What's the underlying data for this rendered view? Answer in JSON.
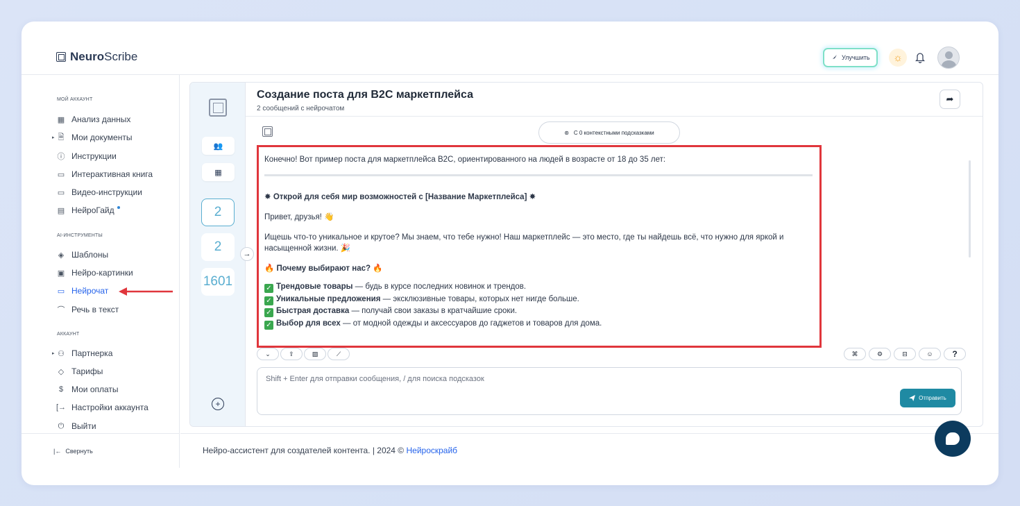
{
  "app": {
    "logo_bold": "Neuro",
    "logo_light": "Scribe"
  },
  "header": {
    "upgrade_label": "Улучшить",
    "sun_icon": "☼",
    "bell_icon": "🔔"
  },
  "sidebar": {
    "sections": [
      {
        "title": "МОЙ АККАУНТ"
      },
      {
        "title": "AI-ИНСТРУМЕНТЫ"
      },
      {
        "title": "АККАУНТ"
      }
    ],
    "account_items": [
      {
        "label": "Анализ данных",
        "icon": "grid-icon"
      },
      {
        "label": "Мои документы",
        "icon": "document-icon"
      },
      {
        "label": "Инструкции",
        "icon": "help-icon"
      },
      {
        "label": "Интерактивная книга",
        "icon": "book-icon"
      },
      {
        "label": "Видео-инструкции",
        "icon": "video-icon"
      },
      {
        "label": "НейроГайд",
        "icon": "guide-icon"
      }
    ],
    "ai_items": [
      {
        "label": "Шаблоны",
        "icon": "layers-icon"
      },
      {
        "label": "Нейро-картинки",
        "icon": "image-icon"
      },
      {
        "label": "Нейрочат",
        "icon": "chat-icon"
      },
      {
        "label": "Речь в текст",
        "icon": "headphones-icon"
      }
    ],
    "settings_items": [
      {
        "label": "Партнерка",
        "icon": "users-icon"
      },
      {
        "label": "Тарифы",
        "icon": "tag-icon"
      },
      {
        "label": "Мои оплаты",
        "icon": "dollar-icon"
      },
      {
        "label": "Настройки аккаунта",
        "icon": "login-icon"
      },
      {
        "label": "Выйти",
        "icon": "power-icon"
      }
    ],
    "collapse_label": "Свернуть"
  },
  "rail": {
    "counts": [
      "2",
      "2",
      "1601"
    ]
  },
  "chat": {
    "title": "Создание поста для B2C маркетплейса",
    "subtitle": "2 сообщений с нейрочатом",
    "context_label": "С 0 контекстными подсказками",
    "message": {
      "intro": "Конечно! Вот пример поста для маркетплейса B2C, ориентированного на людей в возрасте от 18 до 35 лет:",
      "heading": "Открой для себя мир возможностей с [Название Маркетплейса]",
      "greeting": "Привет, друзья!",
      "para": "Ищешь что-то уникальное и крутое? Мы знаем, что тебе нужно! Наш маркетплейс — это место, где ты найдешь всё, что нужно для яркой и насыщенной жизни.",
      "why": "Почему выбирают нас?",
      "list": [
        {
          "bold": "Трендовые товары",
          "rest": " — будь в курсе последних новинок и трендов."
        },
        {
          "bold": "Уникальные предложения",
          "rest": " — эксклюзивные товары, которых нет нигде больше."
        },
        {
          "bold": "Быстрая доставка",
          "rest": " — получай свои заказы в кратчайшие сроки."
        },
        {
          "bold": "Выбор для всех",
          "rest": " — от модной одежды и аксессуаров до гаджетов и товаров для дома."
        }
      ]
    },
    "input_placeholder": "Shift + Enter для отправки сообщения, / для поиска подсказок",
    "send_label": "Отправить"
  },
  "footer": {
    "text": "Нейро-ассистент для создателей контента.  | 2024 © ",
    "link": "Нейроскрайб"
  },
  "colors": {
    "accent": "#2563eb",
    "send": "#1f8aa3",
    "highlight": "#e0363c"
  }
}
